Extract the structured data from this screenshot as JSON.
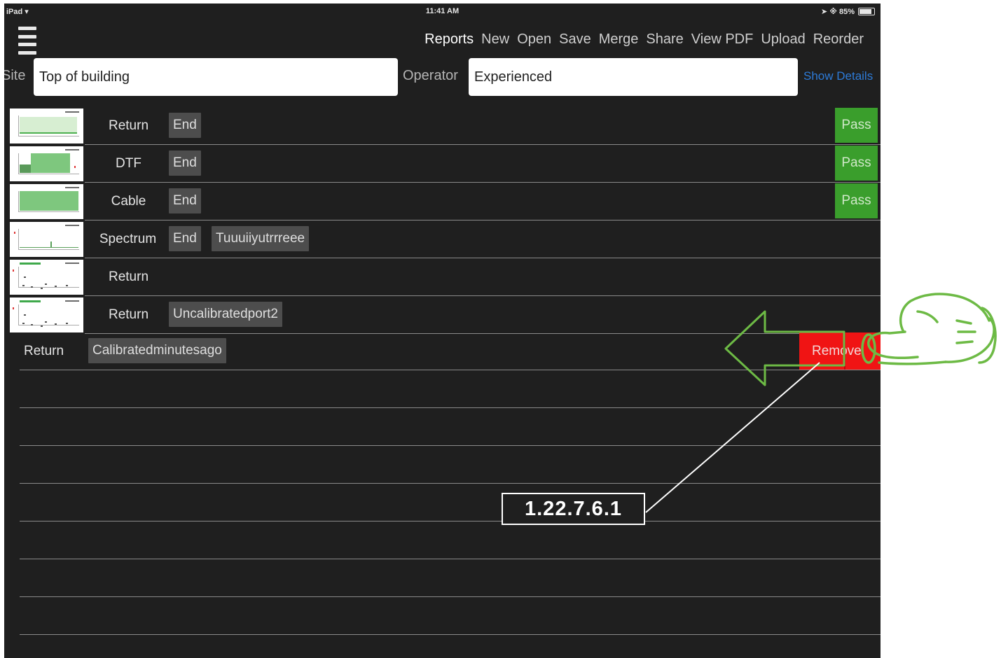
{
  "status_bar": {
    "device": "iPad",
    "time": "11:41 AM",
    "battery_text": "85%"
  },
  "toolbar": {
    "items": [
      "Reports",
      "New",
      "Open",
      "Save",
      "Merge",
      "Share",
      "View PDF",
      "Upload",
      "Reorder"
    ]
  },
  "form": {
    "site_label": "Site",
    "site_value": "Top of building",
    "operator_label": "Operator",
    "operator_value": "Experienced",
    "show_details": "Show Details"
  },
  "measurements": [
    {
      "label": "Return",
      "chips": [
        "End"
      ],
      "status": "Pass"
    },
    {
      "label": "DTF",
      "chips": [
        "End"
      ],
      "status": "Pass"
    },
    {
      "label": "Cable",
      "chips": [
        "End"
      ],
      "status": "Pass"
    },
    {
      "label": "Spectrum",
      "chips": [
        "End",
        "Tuuuiiyutrrreee"
      ],
      "status": ""
    },
    {
      "label": "Return",
      "chips": [],
      "status": ""
    },
    {
      "label": "Return",
      "chips": [
        "Uncalibratedport2"
      ],
      "status": ""
    }
  ],
  "swiped_row": {
    "label": "Return",
    "chip": "Calibratedminutesago",
    "action": "Remove"
  },
  "callout": {
    "text": "1.22.7.6.1"
  },
  "colors": {
    "background": "#1f1f1f",
    "pass": "#3a9e2c",
    "remove": "#f01414",
    "gesture": "#6dba45",
    "link": "#2d7bd8"
  }
}
